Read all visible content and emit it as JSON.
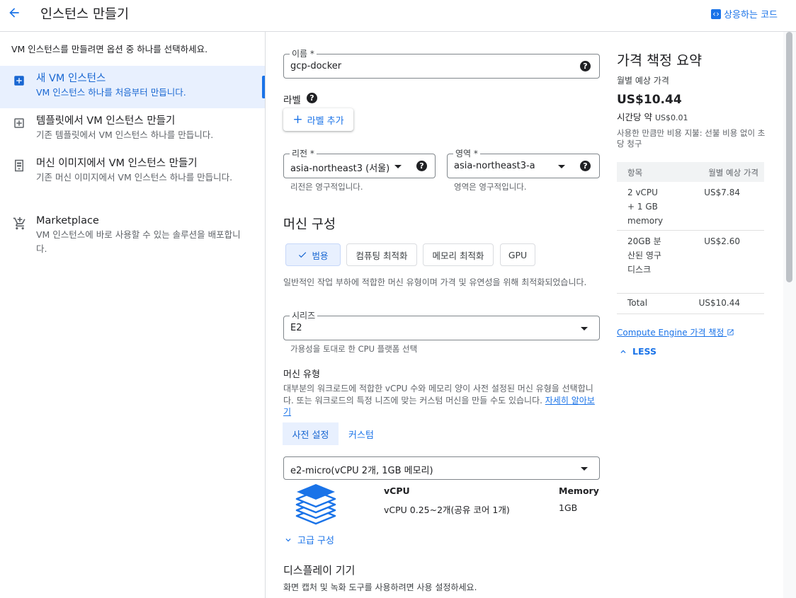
{
  "header": {
    "title": "인스턴스 만들기",
    "code_link": "상응하는 코드"
  },
  "left": {
    "intro": "VM 인스턴스를 만들려면 옵션 중 하나를 선택하세요.",
    "options": [
      {
        "title": "새 VM 인스턴스",
        "desc": "VM 인스턴스 하나를 처음부터 만듭니다.",
        "icon": "add-box-icon"
      },
      {
        "title": "템플릿에서 VM 인스턴스 만들기",
        "desc": "기존 템플릿에서 VM 인스턴스 하나를 만듭니다.",
        "icon": "template-icon"
      },
      {
        "title": "머신 이미지에서 VM 인스턴스 만들기",
        "desc": "기존 머신 이미지에서 VM 인스턴스 하나를 만듭니다.",
        "icon": "machine-image-icon"
      },
      {
        "title": "Marketplace",
        "desc": "VM 인스턴스에 바로 사용할 수 있는 솔루션을 배포합니다.",
        "icon": "cart-icon"
      }
    ]
  },
  "form": {
    "name_label": "이름 *",
    "name_value": "gcp-docker",
    "labels_title": "라벨",
    "add_label": "라벨 추가",
    "region_label": "리전 *",
    "region_value": "asia-northeast3 (서울)",
    "region_hint": "리전은 영구적입니다.",
    "zone_label": "영역 *",
    "zone_value": "asia-northeast3-a",
    "zone_hint": "영역은 영구적입니다.",
    "machine_config_title": "머신 구성",
    "chips": [
      "범용",
      "컴퓨팅 최적화",
      "메모리 최적화",
      "GPU"
    ],
    "chip_desc": "일반적인 작업 부하에 적합한 머신 유형이며 가격 및 유연성을 위해 최적화되었습니다.",
    "series_label": "시리즈",
    "series_value": "E2",
    "series_hint": "가용성을 토대로 한 CPU 플랫폼 선택",
    "machine_type_title": "머신 유형",
    "machine_type_desc": "대부분의 워크로드에 적합한 vCPU 수와 메모리 양이 사전 설정된 머신 유형을 선택합니다. 또는 워크로드의 특정 니즈에 맞는 커스텀 머신을 만들 수도 있습니다.",
    "learn_more": "자세히 알아보기",
    "tabs": [
      "사전 설정",
      "커스텀"
    ],
    "machine_type_value": "e2-micro(vCPU 2개, 1GB 메모리)",
    "spec_head_vcpu": "vCPU",
    "spec_head_mem": "Memory",
    "spec_vcpu": "vCPU 0.25~2개(공유 코어 1개)",
    "spec_mem": "1GB",
    "advanced": "고급 구성",
    "display_title": "디스플레이 기기",
    "display_desc": "화면 캡처 및 녹화 도구를 사용하려면 사용 설정하세요."
  },
  "pricing": {
    "title": "가격 책정 요약",
    "monthly_label": "월별 예상 가격",
    "monthly_amount": "US$10.44",
    "hourly_prefix": "시간당 약",
    "hourly_amount": "US$0.01",
    "note": "사용한 만큼만 비용 지불: 선불 비용 없이 초당 청구",
    "table_head": [
      "항목",
      "월별 예상 가격"
    ],
    "rows": [
      {
        "item": "2 vCPU + 1 GB memory",
        "price": "US$7.84"
      },
      {
        "item": "20GB 분산된 영구 디스크",
        "price": "US$2.60"
      },
      {
        "item": "Total",
        "price": "US$10.44"
      }
    ],
    "link": "Compute Engine 가격 책정",
    "less": "LESS"
  },
  "colors": {
    "accent": "#1a73e8",
    "selected_bg": "#e8f0fe"
  }
}
